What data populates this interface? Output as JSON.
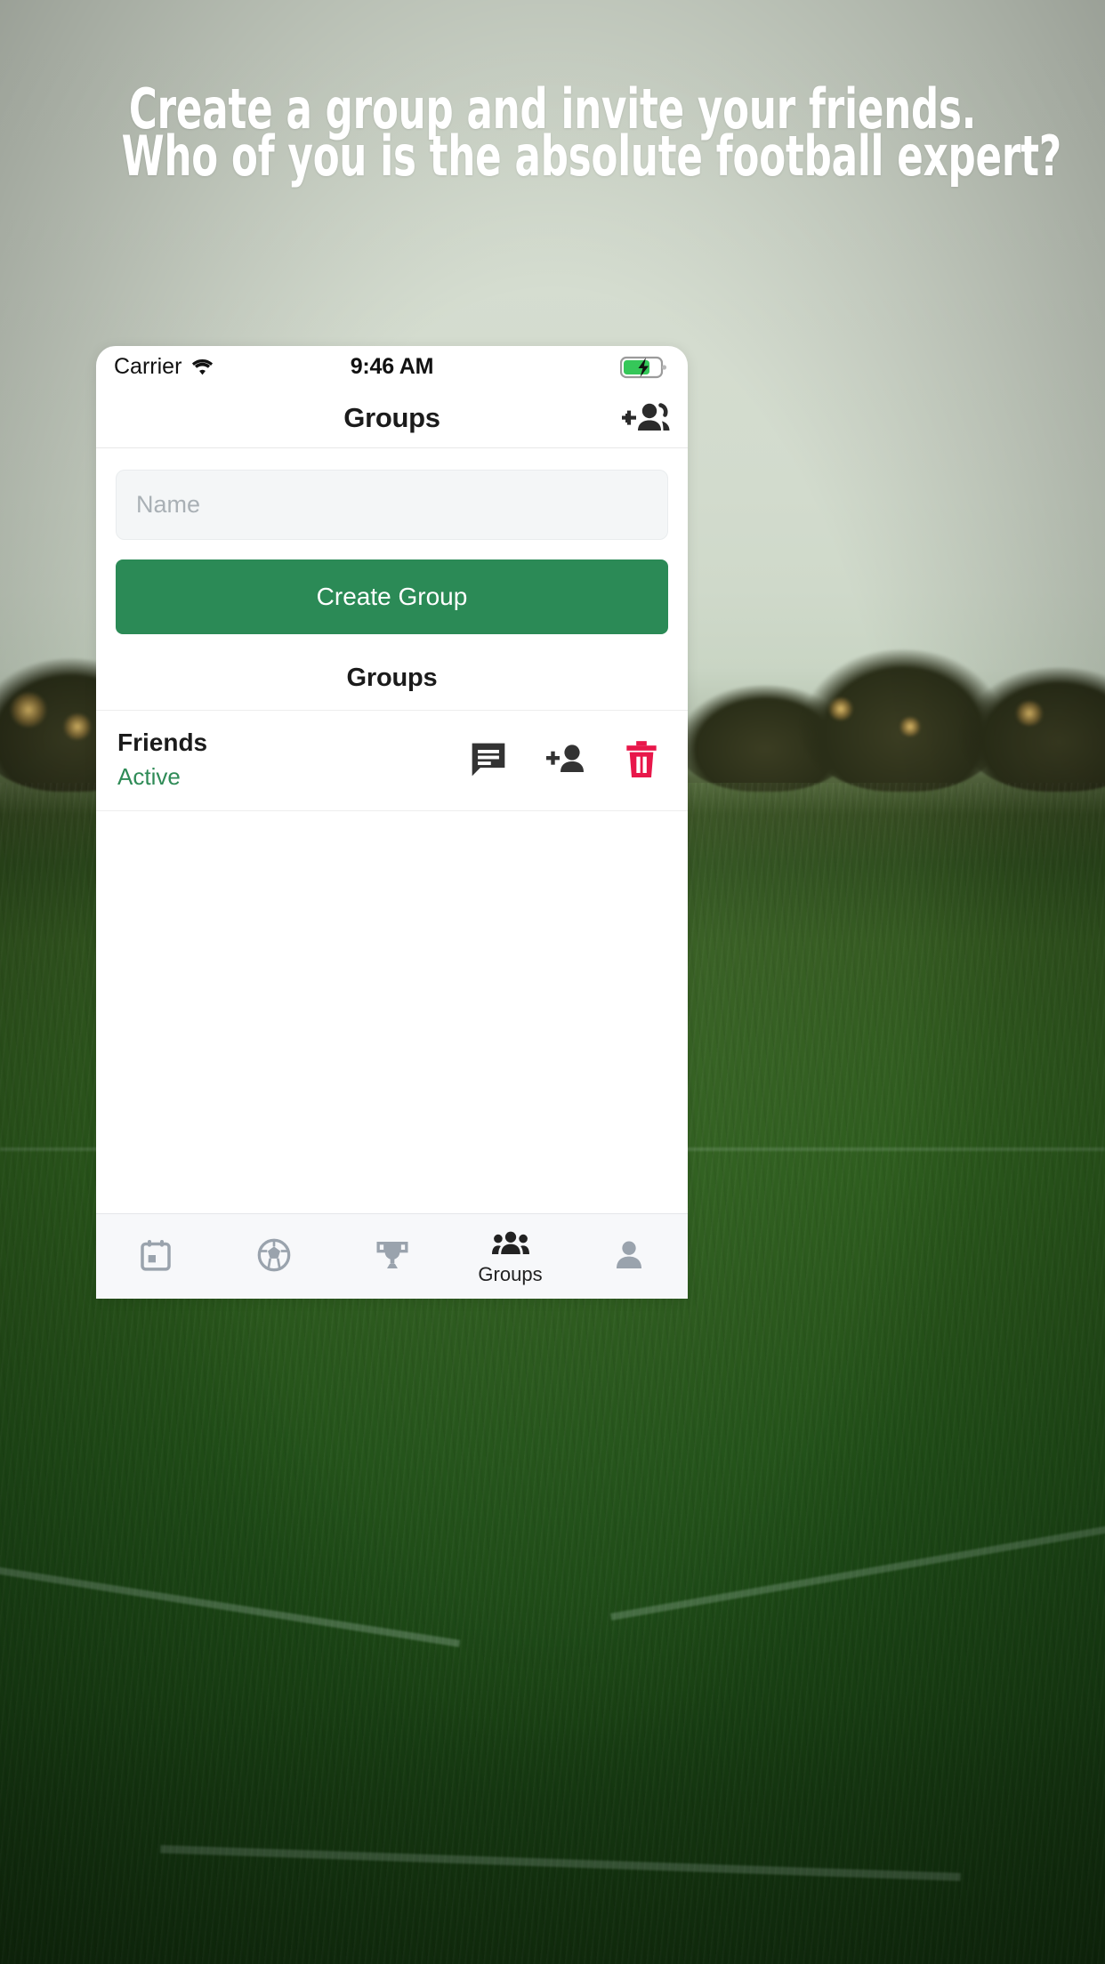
{
  "promo": {
    "headline_line1": "Create a group and invite your friends.",
    "headline_line2": "Who of you is the absolute football expert?",
    "text_color": "#ffffff"
  },
  "phone": {
    "status_bar": {
      "carrier": "Carrier",
      "wifi_icon": "wifi-icon",
      "time": "9:46 AM",
      "battery_icon": "battery-charging-icon",
      "battery_color": "#35c759"
    },
    "nav_bar": {
      "title": "Groups",
      "action_icon": "add-people-icon"
    },
    "form": {
      "name_placeholder": "Name",
      "name_value": "",
      "create_button_label": "Create Group",
      "create_button_color": "#2b8a56"
    },
    "list": {
      "section_title": "Groups",
      "rows": [
        {
          "name": "Friends",
          "status": "Active",
          "status_color": "#2f8b57",
          "actions": [
            {
              "icon": "chat-icon",
              "color": "#333333"
            },
            {
              "icon": "add-person-icon",
              "color": "#333333"
            },
            {
              "icon": "trash-icon",
              "color": "#e8174a"
            }
          ]
        }
      ]
    },
    "tab_bar": {
      "tabs": [
        {
          "icon": "calendar-icon",
          "label": "",
          "active": false
        },
        {
          "icon": "football-icon",
          "label": "",
          "active": false
        },
        {
          "icon": "trophy-icon",
          "label": "",
          "active": false
        },
        {
          "icon": "groups-icon",
          "label": "Groups",
          "active": true
        },
        {
          "icon": "person-icon",
          "label": "",
          "active": false
        }
      ],
      "inactive_color": "#9aa3ad",
      "active_color": "#222222"
    }
  }
}
